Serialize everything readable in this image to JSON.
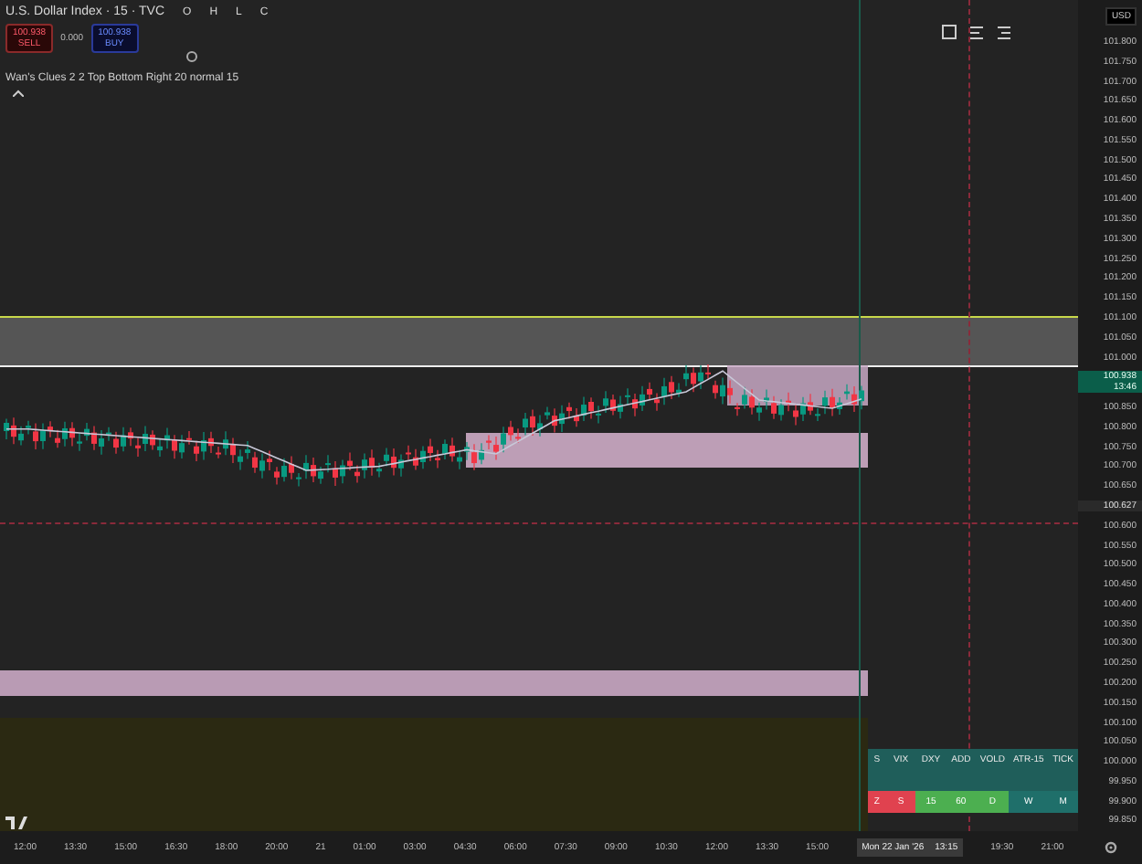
{
  "header": {
    "symbol": "U.S. Dollar Index · 15 · TVC",
    "ohlc": [
      {
        "label": "O"
      },
      {
        "label": "H"
      },
      {
        "label": "L"
      },
      {
        "label": "C"
      }
    ]
  },
  "trade_buttons": [
    {
      "kind": "sell",
      "price": "100.938",
      "label": "SELL"
    },
    {
      "kind": "buy",
      "price": "100.938",
      "label": "BUY"
    }
  ],
  "spread": "0.000",
  "indicator": "Wan's Clues 2 2 Top Bottom Right 20 normal 15",
  "price_axis": {
    "currency": "USD",
    "labels": [
      {
        "kind": "tick",
        "text": "101.800"
      },
      {
        "kind": "tick",
        "text": "101.750"
      },
      {
        "kind": "tick",
        "text": "101.700"
      },
      {
        "kind": "tick",
        "text": "101.650"
      },
      {
        "kind": "tick",
        "text": "101.600"
      },
      {
        "kind": "tick",
        "text": "101.550"
      },
      {
        "kind": "tick",
        "text": "101.500"
      },
      {
        "kind": "tick",
        "text": "101.450"
      },
      {
        "kind": "tick",
        "text": "101.400"
      },
      {
        "kind": "tick",
        "text": "101.350"
      },
      {
        "kind": "tick",
        "text": "101.300"
      },
      {
        "kind": "tick",
        "text": "101.250"
      },
      {
        "kind": "tick",
        "text": "101.200"
      },
      {
        "kind": "tick",
        "text": "101.150"
      },
      {
        "kind": "tick",
        "text": "101.100"
      },
      {
        "kind": "tick",
        "text": "101.050"
      },
      {
        "kind": "tick",
        "text": "101.000"
      },
      {
        "kind": "badge",
        "text": "100.938",
        "sub": "13:46"
      },
      {
        "kind": "tick",
        "text": "100.850"
      },
      {
        "kind": "tick",
        "text": "100.800"
      },
      {
        "kind": "tick",
        "text": "100.750"
      },
      {
        "kind": "tick",
        "text": "100.700"
      },
      {
        "kind": "tick",
        "text": "100.650"
      },
      {
        "kind": "marker",
        "text": "100.627"
      },
      {
        "kind": "tick",
        "text": "100.600"
      },
      {
        "kind": "tick",
        "text": "100.550"
      },
      {
        "kind": "tick",
        "text": "100.500"
      },
      {
        "kind": "tick",
        "text": "100.450"
      },
      {
        "kind": "tick",
        "text": "100.400"
      },
      {
        "kind": "tick",
        "text": "100.350"
      },
      {
        "kind": "tick",
        "text": "100.300"
      },
      {
        "kind": "tick",
        "text": "100.250"
      },
      {
        "kind": "tick",
        "text": "100.200"
      },
      {
        "kind": "tick",
        "text": "100.150"
      },
      {
        "kind": "tick",
        "text": "100.100"
      },
      {
        "kind": "tick",
        "text": "100.050"
      },
      {
        "kind": "tick",
        "text": "100.000"
      },
      {
        "kind": "tick",
        "text": "99.950"
      },
      {
        "kind": "tick",
        "text": "99.900"
      },
      {
        "kind": "tick",
        "text": "99.850"
      }
    ]
  },
  "time_axis": {
    "labels": [
      {
        "kind": "tick",
        "text": "12:00"
      },
      {
        "kind": "tick",
        "text": "13:30"
      },
      {
        "kind": "tick",
        "text": "15:00"
      },
      {
        "kind": "tick",
        "text": "16:30"
      },
      {
        "kind": "tick",
        "text": "18:00"
      },
      {
        "kind": "tick",
        "text": "20:00"
      },
      {
        "kind": "tick",
        "text": "21"
      },
      {
        "kind": "tick",
        "text": "01:00"
      },
      {
        "kind": "tick",
        "text": "03:00"
      },
      {
        "kind": "tick",
        "text": "04:30"
      },
      {
        "kind": "tick",
        "text": "06:00"
      },
      {
        "kind": "tick",
        "text": "07:30"
      },
      {
        "kind": "tick",
        "text": "09:00"
      },
      {
        "kind": "tick",
        "text": "10:30"
      },
      {
        "kind": "tick",
        "text": "12:00"
      },
      {
        "kind": "tick",
        "text": "13:30"
      },
      {
        "kind": "tick",
        "text": "15:00"
      },
      {
        "kind": "crosshair",
        "text": "Mon 22 Jan '26",
        "sub": "13:15"
      },
      {
        "kind": "tick",
        "text": "19:30"
      },
      {
        "kind": "tick",
        "text": "21:00"
      }
    ]
  },
  "table": {
    "header": [
      "S",
      "VIX",
      "DXY",
      "ADD",
      "VOLD",
      "ATR-15",
      "TICK"
    ],
    "timeframes": [
      {
        "label": "Z",
        "color": "#e0424f"
      },
      {
        "label": "S",
        "color": "#e0424f"
      },
      {
        "label": "15",
        "color": "#4caf50"
      },
      {
        "label": "60",
        "color": "#4caf50"
      },
      {
        "label": "D",
        "color": "#4caf50"
      },
      {
        "label": "W",
        "color": "#1f6f6a"
      },
      {
        "label": "M",
        "color": "#1f6f6a"
      }
    ]
  }
}
